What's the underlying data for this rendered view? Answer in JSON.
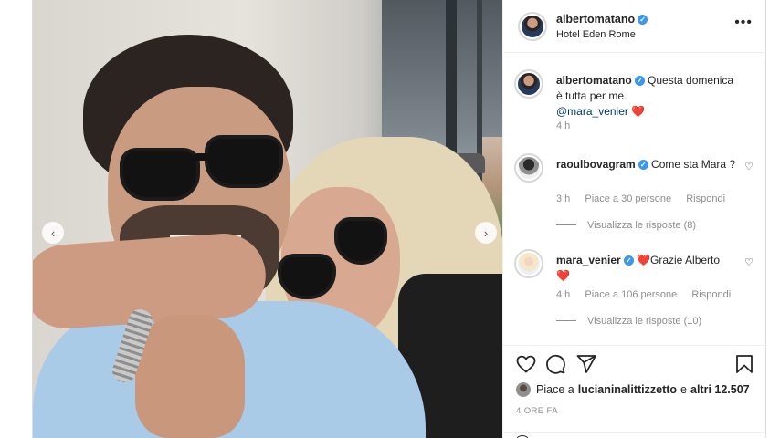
{
  "post": {
    "author": "albertomatano",
    "location": "Hotel Eden Rome",
    "more_label": "•••"
  },
  "comments": [
    {
      "username": "albertomatano",
      "text": "Questa domenica è tutta per me.",
      "mention": "@mara_venier",
      "emoji": "❤️",
      "time": "4 h"
    },
    {
      "username": "raoulbovagram",
      "text": "Come sta Mara ?",
      "time": "3 h",
      "likes": "Piace a 30 persone",
      "reply_label": "Rispondi",
      "view_replies": "Visualizza le risposte (8)"
    },
    {
      "username": "mara_venier",
      "emoji_prefix": "❤️",
      "text": "Grazie Alberto",
      "emoji_suffix": "❤️",
      "time": "4 h",
      "likes": "Piace a 106 persone",
      "reply_label": "Rispondi",
      "view_replies": "Visualizza le risposte (10)"
    }
  ],
  "likes_bar": {
    "prefix": "Piace a",
    "user": "lucianinalittizzetto",
    "middle": "e",
    "others": "altri 12.507"
  },
  "timestamp": "4 ORE FA",
  "icons": {
    "verified": "verified-badge-icon",
    "heart": "heart-icon",
    "comment": "comment-icon",
    "share": "share-icon",
    "save": "bookmark-icon",
    "prev": "chevron-left-icon",
    "next": "chevron-right-icon"
  },
  "colors": {
    "verified_blue": "#3897f0",
    "heart_red": "#ed4956",
    "mention_blue": "#00376b",
    "muted_text": "#8e8e8e"
  }
}
